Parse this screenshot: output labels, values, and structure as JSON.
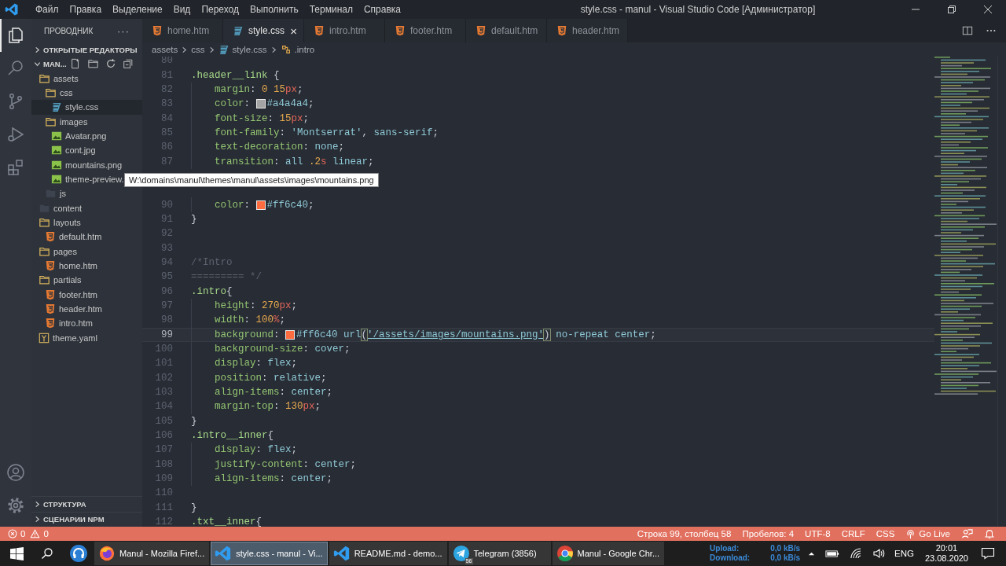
{
  "window": {
    "title": "style.css - manul - Visual Studio Code [Администратор]"
  },
  "menu": [
    "Файл",
    "Правка",
    "Выделение",
    "Вид",
    "Переход",
    "Выполнить",
    "Терминал",
    "Справка"
  ],
  "activity_bar": {
    "items": [
      {
        "kind": "explorer",
        "selected": true
      },
      {
        "kind": "search",
        "selected": false
      },
      {
        "kind": "source-control",
        "selected": false
      },
      {
        "kind": "debug",
        "selected": false
      },
      {
        "kind": "extensions",
        "selected": false
      }
    ],
    "bottom": [
      {
        "kind": "account"
      },
      {
        "kind": "settings"
      }
    ]
  },
  "sidebar": {
    "title": "ПРОВОДНИК",
    "more": "···",
    "sections": [
      {
        "label": "ОТКРЫТЫЕ РЕДАКТОРЫ",
        "expanded": false
      },
      {
        "label": "MAN...",
        "expanded": true
      }
    ],
    "tree": [
      {
        "label": "assets",
        "kind": "folder",
        "selected": false,
        "children": [
          {
            "label": "css",
            "kind": "folder",
            "selected": false,
            "children": [
              {
                "label": "style.css",
                "kind": "css",
                "selected": true
              }
            ]
          },
          {
            "label": "images",
            "kind": "folder",
            "selected": false,
            "children": [
              {
                "label": "Avatar.png",
                "kind": "image",
                "selected": false
              },
              {
                "label": "cont.jpg",
                "kind": "image",
                "selected": false
              },
              {
                "label": "mountains.png",
                "kind": "image",
                "selected": false
              },
              {
                "label": "theme-preview.",
                "kind": "image",
                "selected": false
              }
            ]
          },
          {
            "label": "js",
            "kind": "empty-folder",
            "selected": false
          }
        ]
      },
      {
        "label": "content",
        "kind": "empty-folder",
        "selected": false
      },
      {
        "label": "layouts",
        "kind": "folder",
        "selected": false,
        "children": [
          {
            "label": "default.htm",
            "kind": "html",
            "selected": false
          }
        ]
      },
      {
        "label": "pages",
        "kind": "folder",
        "selected": false,
        "children": [
          {
            "label": "home.htm",
            "kind": "html",
            "selected": false
          }
        ]
      },
      {
        "label": "partials",
        "kind": "folder",
        "selected": false,
        "children": [
          {
            "label": "footer.htm",
            "kind": "html",
            "selected": false
          },
          {
            "label": "header.htm",
            "kind": "html",
            "selected": false
          },
          {
            "label": "intro.htm",
            "kind": "html",
            "selected": false
          }
        ]
      },
      {
        "label": "theme.yaml",
        "kind": "yaml",
        "selected": false
      }
    ],
    "bottom_sections": [
      {
        "label": "СТРУКТУРА",
        "expanded": false
      },
      {
        "label": "СЦЕНАРИИ NPM",
        "expanded": false
      }
    ]
  },
  "tabs": [
    {
      "label": "home.htm",
      "kind": "html",
      "selected": false
    },
    {
      "label": "style.css",
      "kind": "css",
      "selected": true,
      "close": "×"
    },
    {
      "label": "intro.htm",
      "kind": "html",
      "selected": false
    },
    {
      "label": "footer.htm",
      "kind": "html",
      "selected": false
    },
    {
      "label": "default.htm",
      "kind": "html",
      "selected": false
    },
    {
      "label": "header.htm",
      "kind": "html",
      "selected": false
    }
  ],
  "breadcrumb": [
    {
      "label": "assets",
      "kind": "folder"
    },
    {
      "label": "css",
      "kind": "folder"
    },
    {
      "label": "style.css",
      "kind": "css"
    },
    {
      "label": ".intro",
      "kind": "selector"
    }
  ],
  "code": {
    "lines": [
      {
        "number": "80"
      },
      {
        "number": "81",
        "tokens": [
          {
            "kind": "sel",
            "text": ".header__link"
          },
          {
            "kind": "punct",
            "text": " {"
          }
        ]
      },
      {
        "number": "82",
        "indented": true,
        "tokens": [
          {
            "kind": "prop",
            "text": "margin"
          },
          {
            "kind": "punct",
            "text": ": "
          },
          {
            "kind": "num",
            "text": "0 15"
          },
          {
            "kind": "unit",
            "text": "px"
          },
          {
            "kind": "punct",
            "text": ";"
          }
        ]
      },
      {
        "number": "83",
        "indented": true,
        "tokens": [
          {
            "kind": "prop",
            "text": "color"
          },
          {
            "kind": "punct",
            "text": ": "
          },
          {
            "kind": "swatch",
            "color": "#a4a4a4"
          },
          {
            "kind": "val",
            "text": "#a4a4a4"
          },
          {
            "kind": "punct",
            "text": ";"
          }
        ]
      },
      {
        "number": "84",
        "indented": true,
        "tokens": [
          {
            "kind": "prop",
            "text": "font-size"
          },
          {
            "kind": "punct",
            "text": ": "
          },
          {
            "kind": "num",
            "text": "15"
          },
          {
            "kind": "unit",
            "text": "px"
          },
          {
            "kind": "punct",
            "text": ";"
          }
        ]
      },
      {
        "number": "85",
        "indented": true,
        "tokens": [
          {
            "kind": "prop",
            "text": "font-family"
          },
          {
            "kind": "punct",
            "text": ": "
          },
          {
            "kind": "str",
            "text": "'Montserrat'"
          },
          {
            "kind": "punct",
            "text": ", "
          },
          {
            "kind": "val",
            "text": "sans-serif"
          },
          {
            "kind": "punct",
            "text": ";"
          }
        ]
      },
      {
        "number": "86",
        "indented": true,
        "tokens": [
          {
            "kind": "prop",
            "text": "text-decoration"
          },
          {
            "kind": "punct",
            "text": ": "
          },
          {
            "kind": "val",
            "text": "none"
          },
          {
            "kind": "punct",
            "text": ";"
          }
        ]
      },
      {
        "number": "87",
        "indented": true,
        "tokens": [
          {
            "kind": "prop",
            "text": "transition"
          },
          {
            "kind": "punct",
            "text": ": "
          },
          {
            "kind": "val",
            "text": "all "
          },
          {
            "kind": "num",
            "text": ".2"
          },
          {
            "kind": "unit",
            "text": "s"
          },
          {
            "kind": "val",
            "text": " linear"
          },
          {
            "kind": "punct",
            "text": ";"
          }
        ]
      },
      {
        "kind": "covered"
      },
      {
        "kind": "covered"
      },
      {
        "number": "90",
        "indented": true,
        "tokens": [
          {
            "kind": "prop",
            "text": "color"
          },
          {
            "kind": "punct",
            "text": ": "
          },
          {
            "kind": "swatch",
            "color": "#ff6c40"
          },
          {
            "kind": "val",
            "text": "#ff6c40"
          },
          {
            "kind": "punct",
            "text": ";"
          }
        ]
      },
      {
        "number": "91",
        "tokens": [
          {
            "kind": "punct",
            "text": "}"
          }
        ]
      },
      {
        "number": "92"
      },
      {
        "number": "93"
      },
      {
        "number": "94",
        "tokens": [
          {
            "kind": "comment",
            "text": "/*Intro"
          }
        ]
      },
      {
        "number": "95",
        "tokens": [
          {
            "kind": "comment",
            "text": "========= */"
          }
        ]
      },
      {
        "number": "96",
        "tokens": [
          {
            "kind": "sel",
            "text": ".intro"
          },
          {
            "kind": "punct",
            "text": "{"
          }
        ]
      },
      {
        "number": "97",
        "indented": true,
        "tokens": [
          {
            "kind": "prop",
            "text": "height"
          },
          {
            "kind": "punct",
            "text": ": "
          },
          {
            "kind": "num",
            "text": "270"
          },
          {
            "kind": "unit",
            "text": "px"
          },
          {
            "kind": "punct",
            "text": ";"
          }
        ]
      },
      {
        "number": "98",
        "indented": true,
        "tokens": [
          {
            "kind": "prop",
            "text": "width"
          },
          {
            "kind": "punct",
            "text": ": "
          },
          {
            "kind": "num",
            "text": "100"
          },
          {
            "kind": "unit",
            "text": "%"
          },
          {
            "kind": "punct",
            "text": ";"
          }
        ]
      },
      {
        "number": "99",
        "indented": true,
        "current": true,
        "tokens": [
          {
            "kind": "prop",
            "text": "background"
          },
          {
            "kind": "punct",
            "text": ": "
          },
          {
            "kind": "swatch",
            "color": "#ff6c40"
          },
          {
            "kind": "val",
            "text": "#ff6c40 url"
          },
          {
            "kind": "bracket",
            "text": "("
          },
          {
            "kind": "link",
            "text": "'/assets/images/mountains.png'"
          },
          {
            "kind": "bracket",
            "text": ")"
          },
          {
            "kind": "val",
            "text": " no-repeat center"
          },
          {
            "kind": "punct",
            "text": ";"
          }
        ]
      },
      {
        "number": "100",
        "indented": true,
        "tokens": [
          {
            "kind": "prop",
            "text": "background-size"
          },
          {
            "kind": "punct",
            "text": ": "
          },
          {
            "kind": "val",
            "text": "cover"
          },
          {
            "kind": "punct",
            "text": ";"
          }
        ]
      },
      {
        "number": "101",
        "indented": true,
        "tokens": [
          {
            "kind": "prop",
            "text": "display"
          },
          {
            "kind": "punct",
            "text": ": "
          },
          {
            "kind": "val",
            "text": "flex"
          },
          {
            "kind": "punct",
            "text": ";"
          }
        ]
      },
      {
        "number": "102",
        "indented": true,
        "tokens": [
          {
            "kind": "prop",
            "text": "position"
          },
          {
            "kind": "punct",
            "text": ": "
          },
          {
            "kind": "val",
            "text": "relative"
          },
          {
            "kind": "punct",
            "text": ";"
          }
        ]
      },
      {
        "number": "103",
        "indented": true,
        "tokens": [
          {
            "kind": "prop",
            "text": "align-items"
          },
          {
            "kind": "punct",
            "text": ": "
          },
          {
            "kind": "val",
            "text": "center"
          },
          {
            "kind": "punct",
            "text": ";"
          }
        ]
      },
      {
        "number": "104",
        "indented": true,
        "tokens": [
          {
            "kind": "prop",
            "text": "margin-top"
          },
          {
            "kind": "punct",
            "text": ": "
          },
          {
            "kind": "num",
            "text": "130"
          },
          {
            "kind": "unit",
            "text": "px"
          },
          {
            "kind": "punct",
            "text": ";"
          }
        ]
      },
      {
        "number": "105",
        "tokens": [
          {
            "kind": "punct",
            "text": "}"
          }
        ]
      },
      {
        "number": "106",
        "tokens": [
          {
            "kind": "sel",
            "text": ".intro__inner"
          },
          {
            "kind": "punct",
            "text": "{"
          }
        ]
      },
      {
        "number": "107",
        "indented": true,
        "tokens": [
          {
            "kind": "prop",
            "text": "display"
          },
          {
            "kind": "punct",
            "text": ": "
          },
          {
            "kind": "val",
            "text": "flex"
          },
          {
            "kind": "punct",
            "text": ";"
          }
        ]
      },
      {
        "number": "108",
        "indented": true,
        "tokens": [
          {
            "kind": "prop",
            "text": "justify-content"
          },
          {
            "kind": "punct",
            "text": ": "
          },
          {
            "kind": "val",
            "text": "center"
          },
          {
            "kind": "punct",
            "text": ";"
          }
        ]
      },
      {
        "number": "109",
        "indented": true,
        "tokens": [
          {
            "kind": "prop",
            "text": "align-items"
          },
          {
            "kind": "punct",
            "text": ": "
          },
          {
            "kind": "val",
            "text": "center"
          },
          {
            "kind": "punct",
            "text": ";"
          }
        ]
      },
      {
        "number": "110"
      },
      {
        "number": "111",
        "tokens": [
          {
            "kind": "punct",
            "text": "}"
          }
        ]
      },
      {
        "number": "112",
        "tokens": [
          {
            "kind": "sel",
            "text": ".txt__inner"
          },
          {
            "kind": "punct",
            "text": "{"
          }
        ]
      }
    ]
  },
  "tooltip": {
    "text": "W:\\domains\\manul\\themes\\manul\\assets\\images\\mountains.png"
  },
  "status_bar": {
    "left": [
      {
        "kind": "error",
        "text": "0"
      },
      {
        "kind": "warning",
        "text": "0"
      }
    ],
    "right": [
      {
        "kind": "text",
        "text": "Строка 99, столбец 58"
      },
      {
        "kind": "text",
        "text": "Пробелов: 4"
      },
      {
        "kind": "text",
        "text": "UTF-8"
      },
      {
        "kind": "text",
        "text": "CRLF"
      },
      {
        "kind": "text",
        "text": "CSS"
      },
      {
        "kind": "golive",
        "text": "Go Live"
      },
      {
        "kind": "feedback"
      },
      {
        "kind": "bell"
      }
    ]
  },
  "taskbar": {
    "apps": [
      {
        "kind": "firefox",
        "label": "Manul - Mozilla Firef...",
        "selected": false
      },
      {
        "kind": "vscode",
        "label": "style.css - manul - Vi...",
        "selected": true
      },
      {
        "kind": "vscode",
        "label": "README.md - demo...",
        "selected": false
      },
      {
        "kind": "telegram",
        "label": "Telegram (3856)",
        "badge": "56",
        "selected": false
      },
      {
        "kind": "chrome",
        "label": "Manul - Google Chr...",
        "selected": false
      }
    ],
    "tray": {
      "upload_label": "Upload:",
      "upload_value": "0,0 kB/s",
      "download_label": "Download:",
      "download_value": "0,0 kB/s",
      "language": "ENG",
      "time": "20:01",
      "date": "23.08.2020"
    }
  }
}
